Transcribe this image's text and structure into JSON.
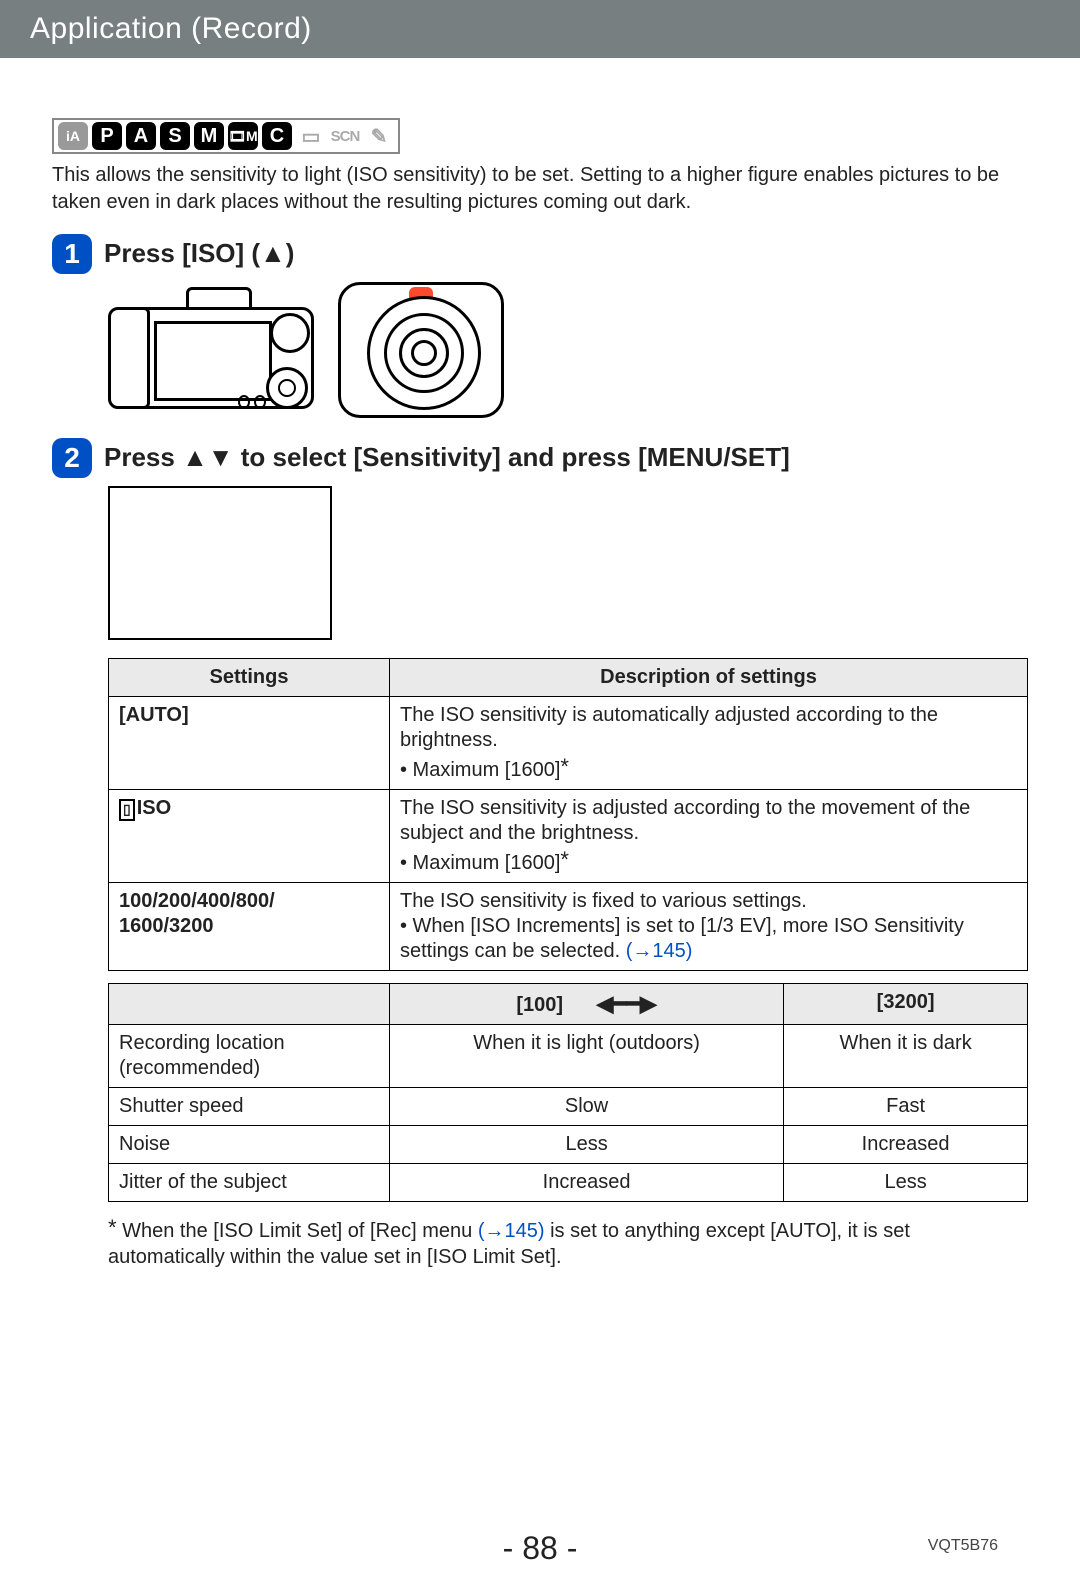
{
  "header": {
    "breadcrumb": "Application (Record)"
  },
  "modes": {
    "ia": "iA",
    "p": "P",
    "a": "A",
    "s": "S",
    "m": "M",
    "mv": "🎞M",
    "c": "C",
    "pan": "▭",
    "scn": "SCN",
    "art": "✎"
  },
  "intro": "This allows the sensitivity to light (ISO sensitivity) to be set. Setting to a higher figure enables pictures to be taken even in dark places without the resulting pictures coming out dark.",
  "steps": {
    "s1_num": "1",
    "s1_title": "Press [ISO] (▲)",
    "s2_num": "2",
    "s2_title": "Press ▲▼ to select [Sensitivity] and press [MENU/SET]"
  },
  "table1": {
    "h1": "Settings",
    "h2": "Description of settings",
    "r1c1": "[AUTO]",
    "r1c2a": "The ISO sensitivity is automatically adjusted according to the brightness.",
    "r1c2b": " • Maximum [1600]",
    "r2c1": "ISO",
    "r2c2a": "The ISO sensitivity is adjusted according to the movement of the subject and the brightness.",
    "r2c2b": " • Maximum [1600]",
    "r3c1": "100/200/400/800/\n1600/3200",
    "r3c2a": "The ISO sensitivity is fixed to various settings.",
    "r3c2b": " • When [ISO Increments] is set to [1/3 EV], more ISO Sensitivity settings can be selected. ",
    "r3link": "(→145)"
  },
  "table2": {
    "h1": "",
    "h2": "[100]",
    "arrow": "◀━━▶",
    "h3": "[3200]",
    "rows": [
      {
        "a": "Recording location\n(recommended)",
        "b": "When it is light (outdoors)",
        "c": "When it is dark"
      },
      {
        "a": "Shutter speed",
        "b": "Slow",
        "c": "Fast"
      },
      {
        "a": "Noise",
        "b": "Less",
        "c": "Increased"
      },
      {
        "a": "Jitter of the subject",
        "b": "Increased",
        "c": "Less"
      }
    ]
  },
  "footnote": {
    "star": "*",
    "a": "When the [ISO Limit Set] of [Rec] menu ",
    "link": "(→145)",
    "b": " is set to anything except [AUTO], it is set automatically within the value set in [ISO Limit Set]."
  },
  "footer": {
    "page": "- 88 -",
    "docid": "VQT5B76"
  }
}
